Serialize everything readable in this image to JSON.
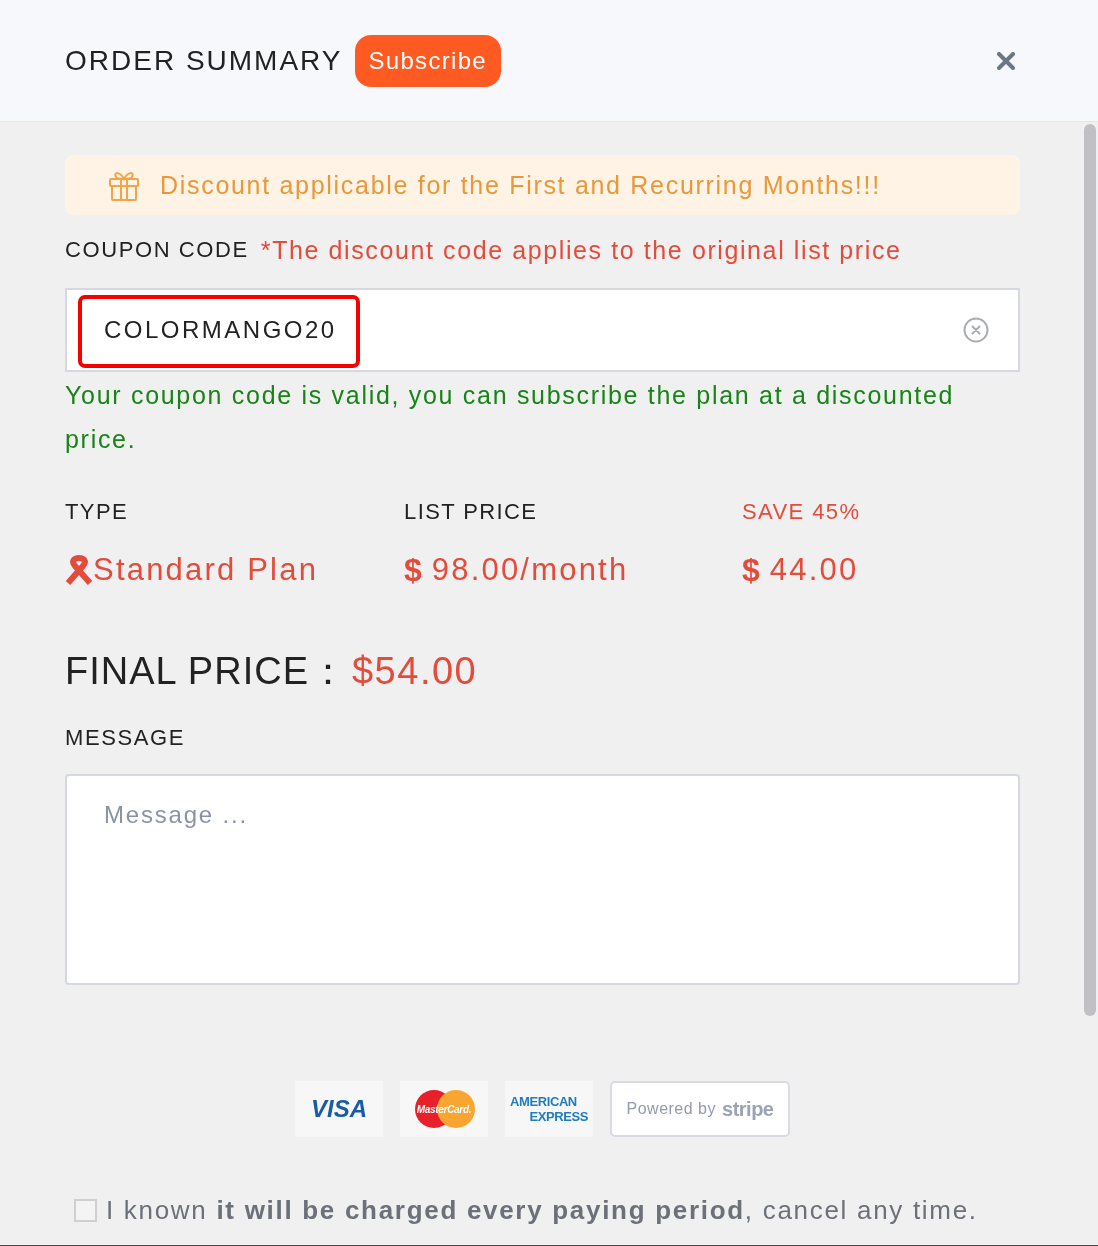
{
  "header": {
    "title": "ORDER SUMMARY",
    "badge": "Subscribe"
  },
  "notice": {
    "text": "Discount applicable for the First and Recurring Months!!!"
  },
  "coupon": {
    "label": "COUPON CODE",
    "note": "*The discount code applies to the original list price",
    "value": "COLORMANGO20",
    "highlighted": true,
    "valid": true,
    "status": "Your coupon code is valid, you can subscribe the plan at a discounted price."
  },
  "plan": {
    "columns": [
      {
        "kind": "type",
        "heading": "TYPE",
        "value": "Standard Plan"
      },
      {
        "kind": "price",
        "heading": "LIST PRICE",
        "symbol": "$",
        "value": "98.00/month"
      },
      {
        "kind": "saving",
        "heading": "SAVE 45%",
        "symbol": "$",
        "value": "44.00"
      }
    ]
  },
  "final": {
    "label": "FINAL PRICE：",
    "value": "$54.00"
  },
  "message": {
    "label": "MESSAGE",
    "placeholder": "Message ..."
  },
  "payments": [
    {
      "kind": "visa",
      "lines": [
        "VISA"
      ]
    },
    {
      "kind": "mastercard",
      "lines": [
        "MasterCard."
      ]
    },
    {
      "kind": "amex",
      "lines": [
        "AMERICAN",
        "EXPRESS"
      ]
    },
    {
      "kind": "stripe",
      "lines": [
        "Powered by",
        "stripe"
      ]
    }
  ],
  "agreement": {
    "checked": false,
    "text": "I known **it will be charged every paying period**, cancel any time."
  }
}
